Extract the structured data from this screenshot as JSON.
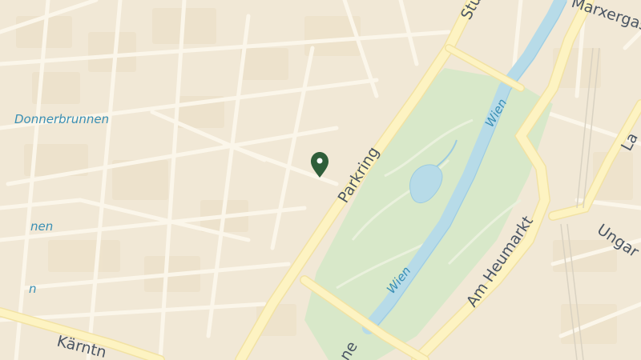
{
  "colors": {
    "land": "#f1e8d6",
    "block": "#ecdfc6",
    "minor_road": "#fbf6ea",
    "main_road": "#fdf3c2",
    "main_road_edge": "#f2e2a3",
    "park": "#d8e8c9",
    "park_path": "#eaf1dd",
    "water": "#b7dbe8",
    "water_edge": "#9ccbe0",
    "marker": "#2f5e3a",
    "label_road": "#4a5563",
    "label_water": "#3a8fb4"
  },
  "labels": {
    "parkring": "Parkring",
    "am_heumarkt": "Am Heumarkt",
    "donnerbrunnen": "Donnerbrunnen",
    "nen": "nen",
    "wien_upper": "Wien",
    "wien_lower": "Wien",
    "kaerntner": "Kärntn",
    "marxergasse": "Marxergas",
    "ungar": "Ungar",
    "stu": "Stu",
    "la": "La",
    "ne": "ne",
    "n_small": "n"
  },
  "marker": {
    "icon": "map-pin-icon"
  }
}
